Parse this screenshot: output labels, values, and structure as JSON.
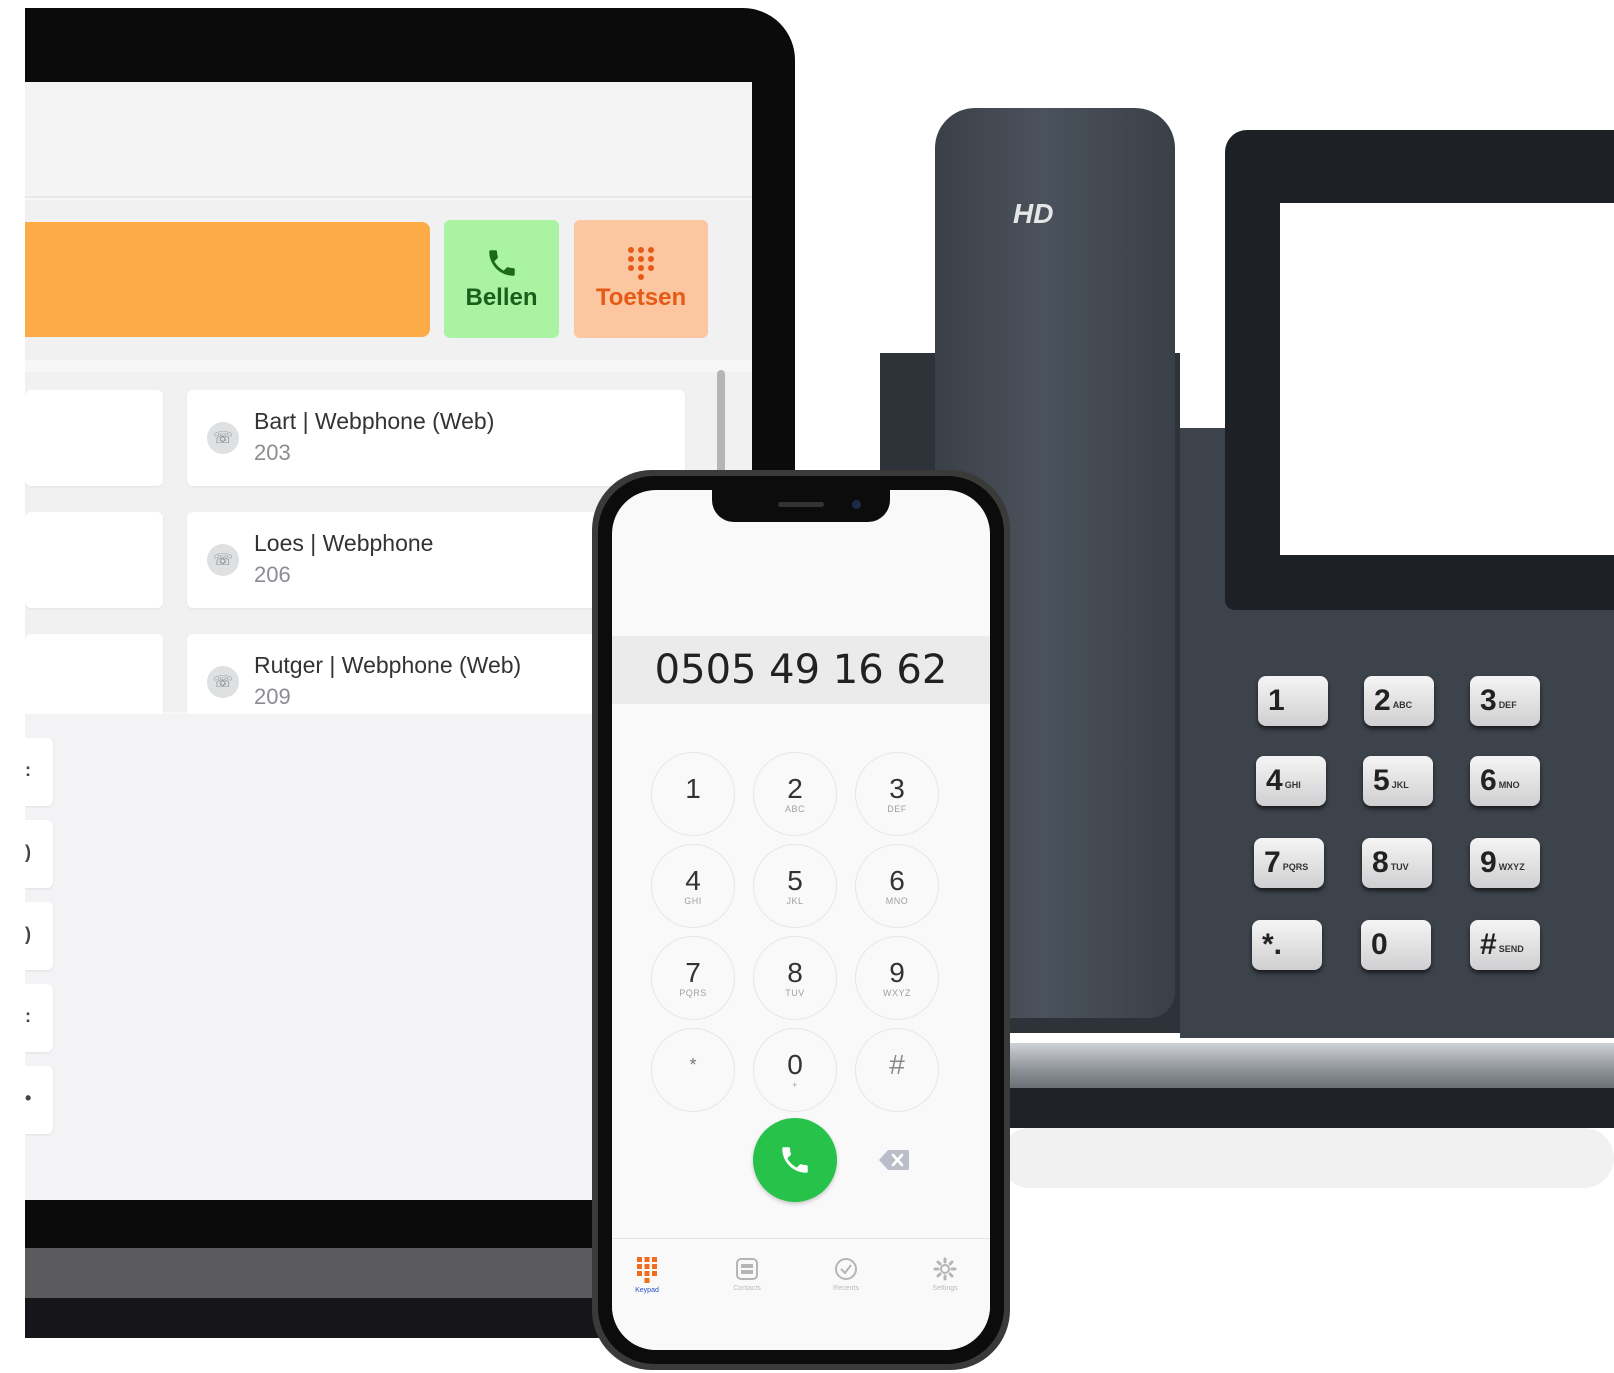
{
  "webapp": {
    "call_button_label": "Bellen",
    "keypad_button_label": "Toetsen",
    "contacts": [
      {
        "name": "Bart | Webphone (Web)",
        "ext": "203"
      },
      {
        "name": "Loes | Webphone",
        "ext": "206"
      },
      {
        "name": "Rutger | Webphone (Web)",
        "ext": "209"
      }
    ],
    "side_tabs": [
      ":",
      ")",
      ")",
      ":",
      "•"
    ]
  },
  "desk_phone": {
    "brand_mark": "HD",
    "keys": [
      {
        "digit": "1",
        "letters": ""
      },
      {
        "digit": "2",
        "letters": "ABC"
      },
      {
        "digit": "3",
        "letters": "DEF"
      },
      {
        "digit": "4",
        "letters": "GHI"
      },
      {
        "digit": "5",
        "letters": "JKL"
      },
      {
        "digit": "6",
        "letters": "MNO"
      },
      {
        "digit": "7",
        "letters": "PQRS"
      },
      {
        "digit": "8",
        "letters": "TUV"
      },
      {
        "digit": "9",
        "letters": "WXYZ"
      },
      {
        "digit": "*.",
        "letters": ""
      },
      {
        "digit": "0",
        "letters": ""
      },
      {
        "digit": "#",
        "letters": "SEND"
      }
    ]
  },
  "mobile": {
    "dialed_number": "0505 49 16 62",
    "keys": [
      {
        "digit": "1",
        "letters": ""
      },
      {
        "digit": "2",
        "letters": "ABC"
      },
      {
        "digit": "3",
        "letters": "DEF"
      },
      {
        "digit": "4",
        "letters": "GHI"
      },
      {
        "digit": "5",
        "letters": "JKL"
      },
      {
        "digit": "6",
        "letters": "MNO"
      },
      {
        "digit": "7",
        "letters": "PQRS"
      },
      {
        "digit": "8",
        "letters": "TUV"
      },
      {
        "digit": "9",
        "letters": "WXYZ"
      },
      {
        "digit": "*",
        "letters": ""
      },
      {
        "digit": "0",
        "letters": "+"
      },
      {
        "digit": "#",
        "letters": ""
      }
    ],
    "tabs": [
      {
        "label": "Keypad",
        "icon": "keypad-icon",
        "active": true
      },
      {
        "label": "Contacts",
        "icon": "contacts-icon",
        "active": false
      },
      {
        "label": "Recents",
        "icon": "recents-icon",
        "active": false
      },
      {
        "label": "Settings",
        "icon": "settings-icon",
        "active": false
      }
    ]
  },
  "colors": {
    "orange_input": "#fcab47",
    "bellen_bg": "#a9f3a2",
    "toetsen_bg": "#fbc6a0",
    "call_green": "#27c24a",
    "active_tab": "#2a50c7"
  }
}
